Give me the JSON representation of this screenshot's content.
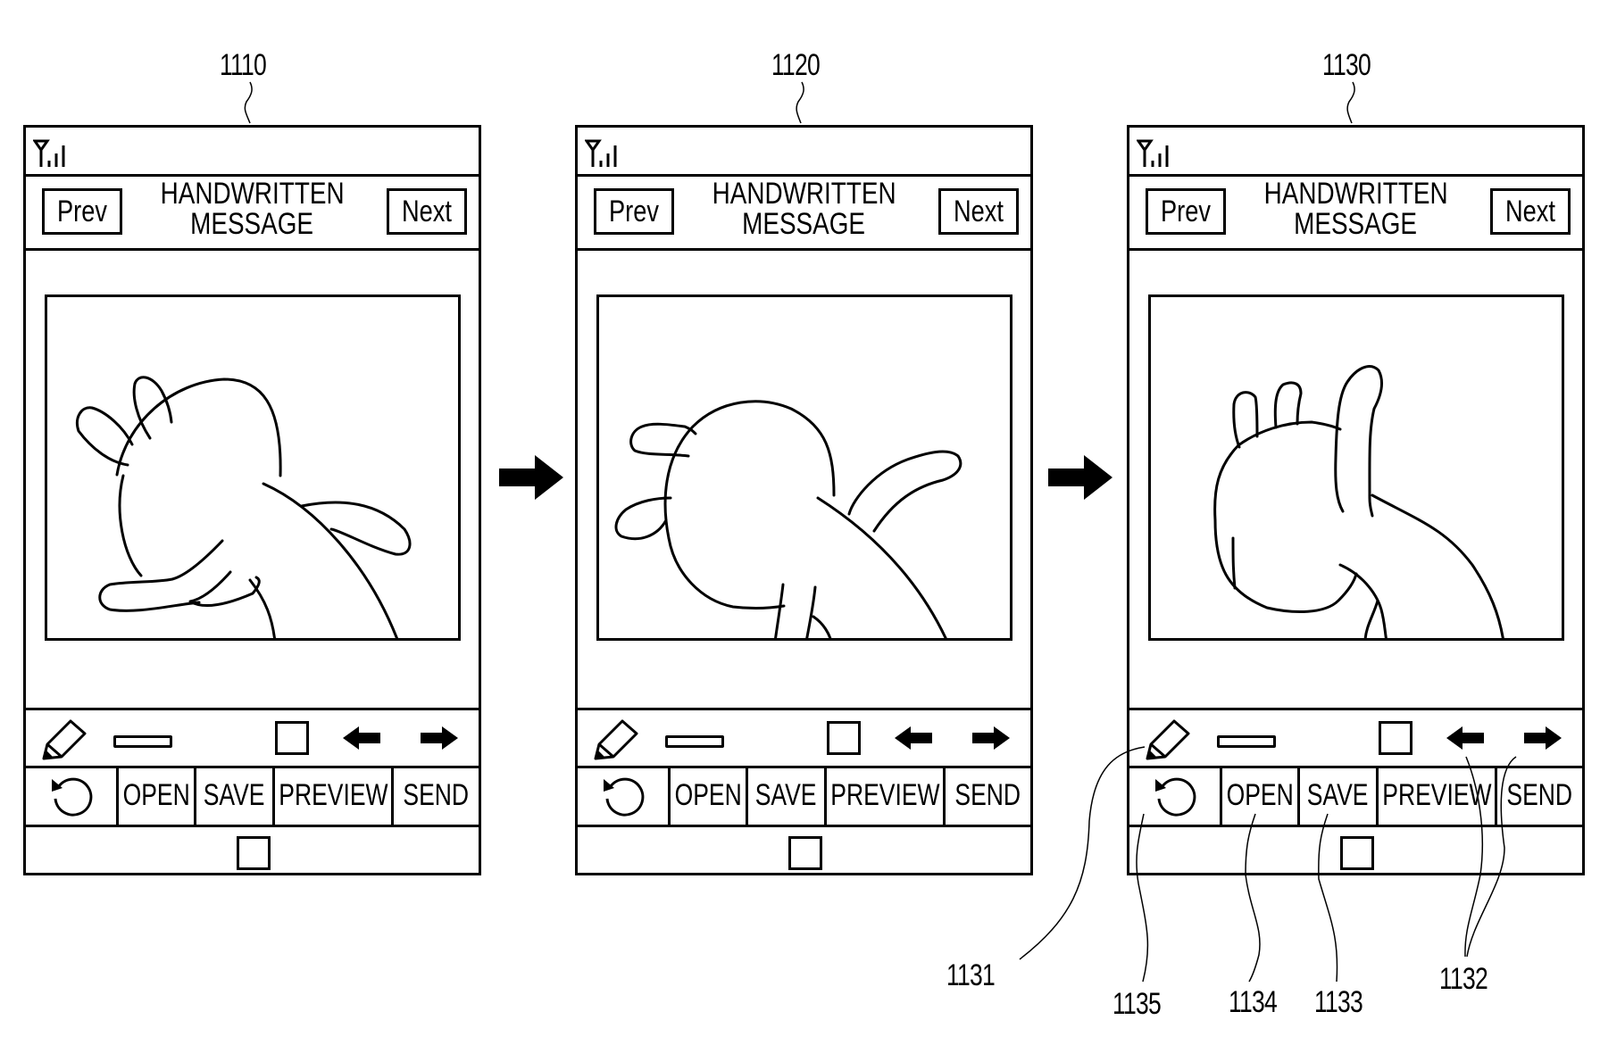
{
  "figure": {
    "references": {
      "screen_1": "1110",
      "screen_2": "1120",
      "screen_3": "1130",
      "pen_tool": "1131",
      "page_arrows": "1132",
      "save_button": "1133",
      "open_button": "1134",
      "undo_button": "1135"
    }
  },
  "screens": [
    {
      "id": "1110",
      "status_icon": "signal-strength-icon",
      "prev_label": "Prev",
      "title_line1": "HANDWRITTEN",
      "title_line2": "MESSAGE",
      "next_label": "Next",
      "drawing": "figure-with-two-ears-and-two-arms",
      "toolbar": [
        "pencil-icon",
        "line-thickness-icon",
        "square-icon",
        "arrow-left-icon",
        "arrow-right-icon"
      ],
      "buttons": {
        "undo": "undo-icon",
        "open": "OPEN",
        "save": "SAVE",
        "preview": "PREVIEW",
        "send": "SEND"
      },
      "nav": "home-square-icon"
    },
    {
      "id": "1120",
      "status_icon": "signal-strength-icon",
      "prev_label": "Prev",
      "title_line1": "HANDWRITTEN",
      "title_line2": "MESSAGE",
      "next_label": "Next",
      "drawing": "figure-with-ears-left-and-arm-up-right",
      "toolbar": [
        "pencil-icon",
        "line-thickness-icon",
        "square-icon",
        "arrow-left-icon",
        "arrow-right-icon"
      ],
      "buttons": {
        "undo": "undo-icon",
        "open": "OPEN",
        "save": "SAVE",
        "preview": "PREVIEW",
        "send": "SEND"
      },
      "nav": "home-square-icon"
    },
    {
      "id": "1130",
      "status_icon": "signal-strength-icon",
      "prev_label": "Prev",
      "title_line1": "HANDWRITTEN",
      "title_line2": "MESSAGE",
      "next_label": "Next",
      "drawing": "figure-with-three-raised-fingers",
      "toolbar": [
        "pencil-icon",
        "line-thickness-icon",
        "square-icon",
        "arrow-left-icon",
        "arrow-right-icon"
      ],
      "buttons": {
        "undo": "undo-icon",
        "open": "OPEN",
        "save": "SAVE",
        "preview": "PREVIEW",
        "send": "SEND"
      },
      "nav": "home-square-icon"
    }
  ],
  "flow_arrows": [
    "right-arrow-icon",
    "right-arrow-icon"
  ]
}
